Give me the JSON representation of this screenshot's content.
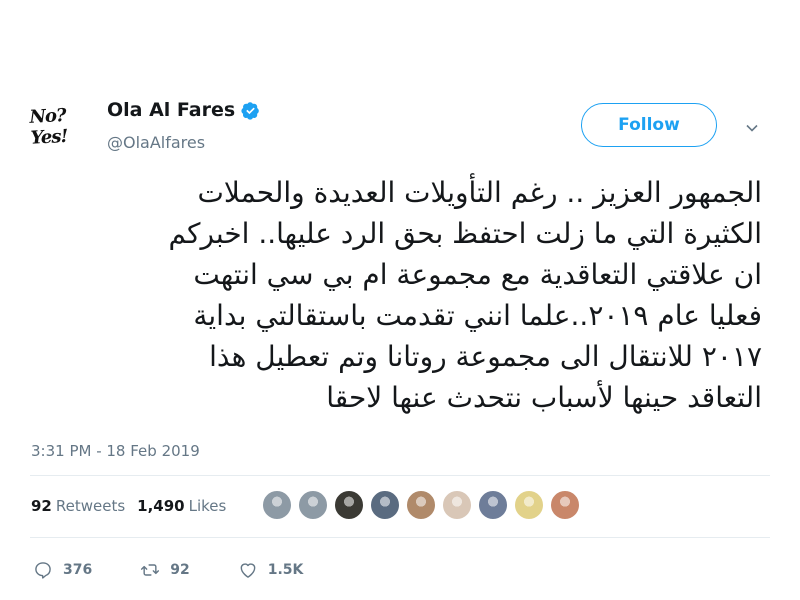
{
  "author": {
    "display_name": "Ola Al Fares",
    "handle": "@OlaAlfares",
    "avatar_text": "No? Yes!"
  },
  "follow_label": "Follow",
  "tweet": {
    "lines": [
      "الجمهور العزيز .. رغم التأويلات العديدة والحملات",
      "الكثيرة التي ما زلت احتفظ بحق الرد عليها..  اخبركم",
      "ان علاقتي التعاقدية مع مجموعة ام بي سي انتهت",
      "فعليا عام ٢٠١٩..علما انني تقدمت باستقالتي بداية",
      "٢٠١٧  للانتقال الى مجموعة روتانا وتم تعطيل هذا",
      "التعاقد  حينها لأسباب نتحدث عنها لاحقا"
    ]
  },
  "timestamp": "3:31 PM - 18 Feb 2019",
  "stats": {
    "retweets_count": "92",
    "retweets_label": "Retweets",
    "likes_count": "1,490",
    "likes_label": "Likes"
  },
  "likers": [
    {
      "color": "#8d9aa5"
    },
    {
      "color": "#8d9aa5"
    },
    {
      "color": "#3b3a34"
    },
    {
      "color": "#5a6b80"
    },
    {
      "color": "#b08a6a"
    },
    {
      "color": "#d9c7b7"
    },
    {
      "color": "#6e7d99"
    },
    {
      "color": "#e2d28a"
    },
    {
      "color": "#c9876a"
    }
  ],
  "actions": {
    "replies": "376",
    "retweets": "92",
    "likes": "1.5K"
  },
  "colors": {
    "accent": "#1da1f2",
    "verified": "#1da1f2",
    "muted": "#657786"
  },
  "icons": {
    "verified": "verified-badge-icon",
    "menu": "chevron-down-icon",
    "reply": "reply-icon",
    "retweet": "retweet-icon",
    "like": "heart-icon"
  }
}
